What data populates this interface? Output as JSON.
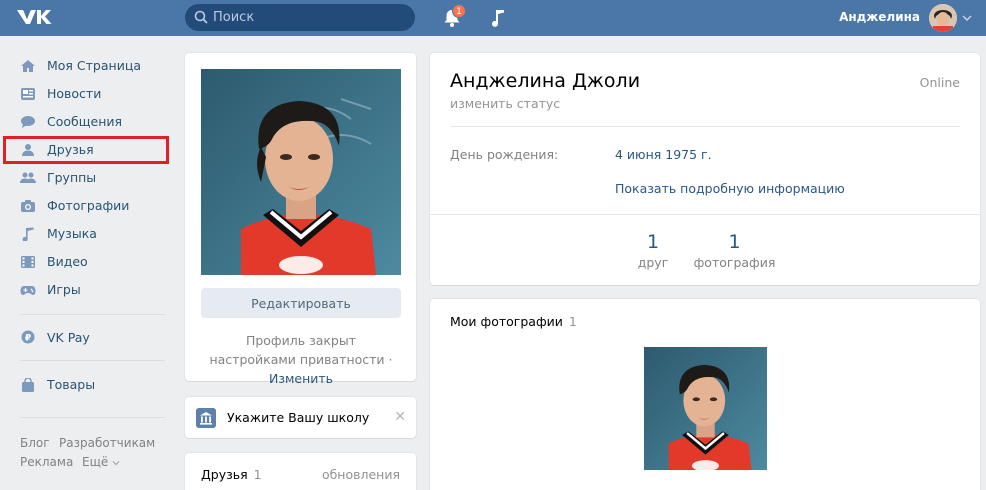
{
  "header": {
    "search_placeholder": "Поиск",
    "notifications_count": "1",
    "user_name": "Анджелина"
  },
  "sidebar": {
    "items": [
      {
        "label": "Моя Страница",
        "icon": "home-icon"
      },
      {
        "label": "Новости",
        "icon": "news-icon"
      },
      {
        "label": "Сообщения",
        "icon": "messages-icon"
      },
      {
        "label": "Друзья",
        "icon": "friends-icon"
      },
      {
        "label": "Группы",
        "icon": "groups-icon"
      },
      {
        "label": "Фотографии",
        "icon": "camera-icon"
      },
      {
        "label": "Музыка",
        "icon": "music-icon"
      },
      {
        "label": "Видео",
        "icon": "video-icon"
      },
      {
        "label": "Игры",
        "icon": "games-icon"
      }
    ],
    "vkpay": "VK Pay",
    "goods": "Товары",
    "footer": {
      "blog": "Блог",
      "developers": "Разработчикам",
      "ads": "Реклама",
      "more": "Ещё"
    }
  },
  "profile_card": {
    "edit_button": "Редактировать",
    "privacy_text": "Профиль закрыт настройками приватности",
    "privacy_sep": "·",
    "privacy_link": "Изменить"
  },
  "school_card": {
    "text": "Укажите Вашу школу"
  },
  "friends_card": {
    "title": "Друзья",
    "count": "1",
    "updates": "обновления"
  },
  "info_card": {
    "name": "Анджелина Джоли",
    "status_link": "изменить статус",
    "online": "Online",
    "birthday_label": "День рождения:",
    "birthday_value": "4 июня 1975 г.",
    "more_info": "Показать подробную информацию",
    "counters": [
      {
        "num": "1",
        "label": "друг"
      },
      {
        "num": "1",
        "label": "фотография"
      }
    ]
  },
  "photos_card": {
    "title": "Мои фотографии",
    "count": "1"
  },
  "colors": {
    "header": "#4a76a8",
    "link": "#2a5885",
    "highlight": "#e31e24",
    "background": "#edeef0"
  }
}
